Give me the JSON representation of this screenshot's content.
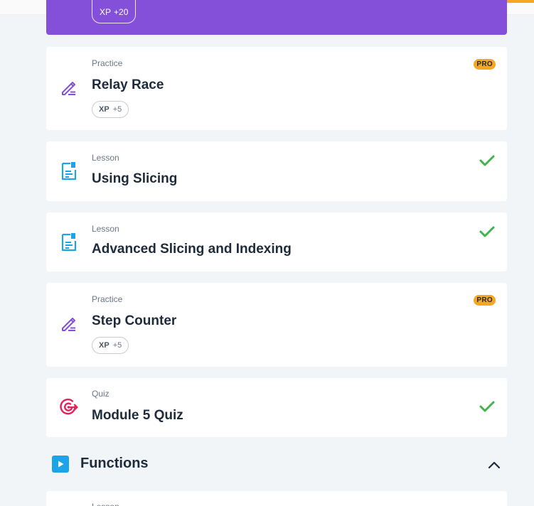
{
  "top_banner": {
    "xp_label": "XP",
    "xp_value": "+20"
  },
  "cards": [
    {
      "type": "Practice",
      "title": "Relay Race",
      "xp_label": "XP",
      "xp_value": "+5",
      "badge": "PRO",
      "icon": "pencil-icon"
    },
    {
      "type": "Lesson",
      "title": "Using Slicing",
      "completed": true,
      "icon": "lesson-document-icon"
    },
    {
      "type": "Lesson",
      "title": "Advanced Slicing and Indexing",
      "completed": true,
      "icon": "lesson-document-icon"
    },
    {
      "type": "Practice",
      "title": "Step Counter",
      "xp_label": "XP",
      "xp_value": "+5",
      "badge": "PRO",
      "icon": "pencil-icon"
    },
    {
      "type": "Quiz",
      "title": "Module 5 Quiz",
      "completed": true,
      "icon": "target-icon"
    }
  ],
  "section": {
    "title": "Functions",
    "expanded": true
  },
  "next_card": {
    "type": "Lesson"
  },
  "colors": {
    "purple": "#8450da",
    "pro_badge": "#f6a623",
    "check": "#3fb54c",
    "lesson_icon": "#1fa3e8",
    "practice_icon": "#8450da",
    "quiz_icon": "#e0245e"
  }
}
